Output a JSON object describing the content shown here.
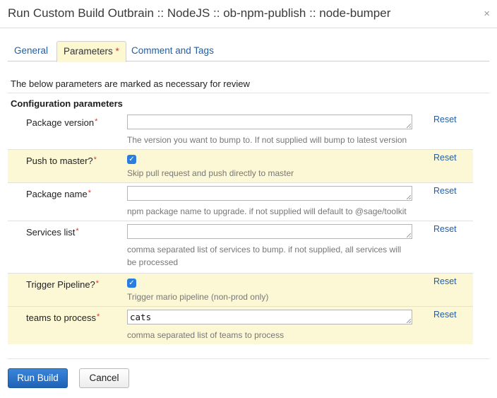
{
  "dialog": {
    "title": "Run Custom Build Outbrain :: NodeJS :: ob-npm-publish :: node-bumper",
    "close_glyph": "×"
  },
  "tabs": [
    {
      "label": "General",
      "active": false
    },
    {
      "label": "Parameters",
      "marker": "*",
      "active": true
    },
    {
      "label": "Comment and Tags",
      "active": false
    }
  ],
  "intro": "The below parameters are marked as necessary for review",
  "section_title": "Configuration parameters",
  "params": [
    {
      "label": "Package version",
      "required": "*",
      "type": "text",
      "value": "",
      "hint": "The version you want to bump to. If not supplied will bump to latest version",
      "reset": "Reset",
      "highlighted": false
    },
    {
      "label": "Push to master?",
      "required": "*",
      "type": "checkbox",
      "checked": true,
      "hint": "Skip pull request and push directly to master",
      "reset": "Reset",
      "highlighted": true
    },
    {
      "label": "Package name",
      "required": "*",
      "type": "text",
      "value": "",
      "hint": "npm package name to upgrade. if not supplied will default to @sage/toolkit",
      "reset": "Reset",
      "highlighted": false
    },
    {
      "label": "Services list",
      "required": "*",
      "type": "text",
      "value": "",
      "hint": "comma separated list of services to bump. if not supplied, all services will be processed",
      "reset": "Reset",
      "highlighted": false
    },
    {
      "label": "Trigger Pipeline?",
      "required": "*",
      "type": "checkbox",
      "checked": true,
      "hint": "Trigger mario pipeline (non-prod only)",
      "reset": "Reset",
      "highlighted": true
    },
    {
      "label": "teams to process",
      "required": "*",
      "type": "text",
      "value": "cats",
      "hint": "comma separated list of teams to process",
      "reset": "Reset",
      "highlighted": true
    }
  ],
  "buttons": {
    "run": "Run Build",
    "cancel": "Cancel"
  },
  "colors": {
    "accent": "#1f62b6",
    "link": "#1f5fa8",
    "required": "#d9342b",
    "highlight_row": "#fcf8d6"
  },
  "icons": {
    "close": "close-icon",
    "checkbox": "checkmark-icon"
  }
}
